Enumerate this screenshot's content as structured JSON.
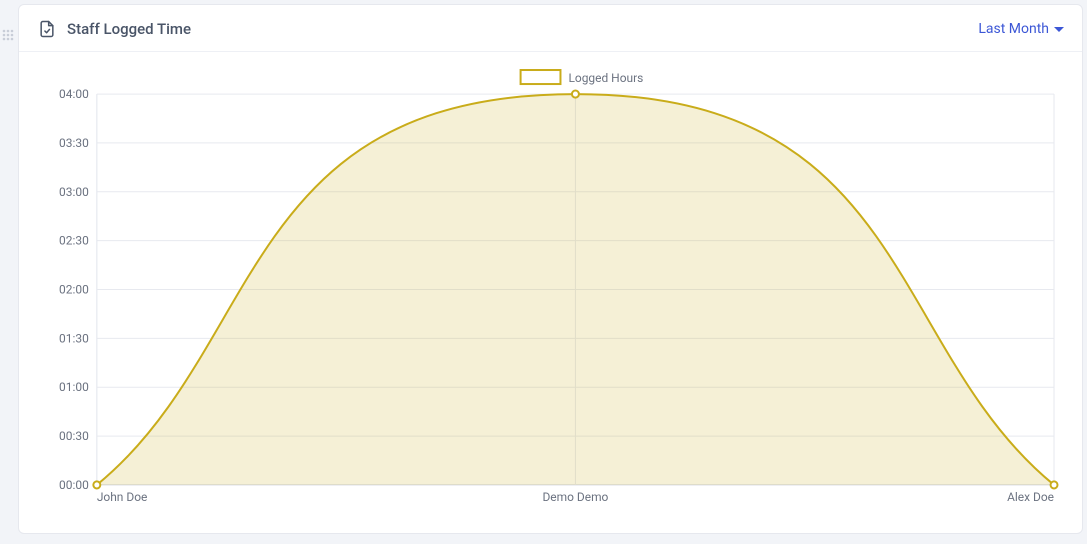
{
  "header": {
    "title": "Staff Logged Time",
    "range_label": "Last Month"
  },
  "legend": {
    "series_label": "Logged Hours"
  },
  "chart_data": {
    "type": "area",
    "categories": [
      "John Doe",
      "Demo Demo",
      "Alex Doe"
    ],
    "series": [
      {
        "name": "Logged Hours",
        "values": [
          0.0,
          4.0,
          0.0
        ]
      }
    ],
    "y_ticks": [
      "00:00",
      "00:30",
      "01:00",
      "01:30",
      "02:00",
      "02:30",
      "03:00",
      "03:30",
      "04:00"
    ],
    "y_tick_values": [
      0,
      0.5,
      1,
      1.5,
      2,
      2.5,
      3,
      3.5,
      4
    ],
    "ylim": [
      0,
      4
    ],
    "xlabel": "",
    "ylabel": "",
    "title": ""
  }
}
